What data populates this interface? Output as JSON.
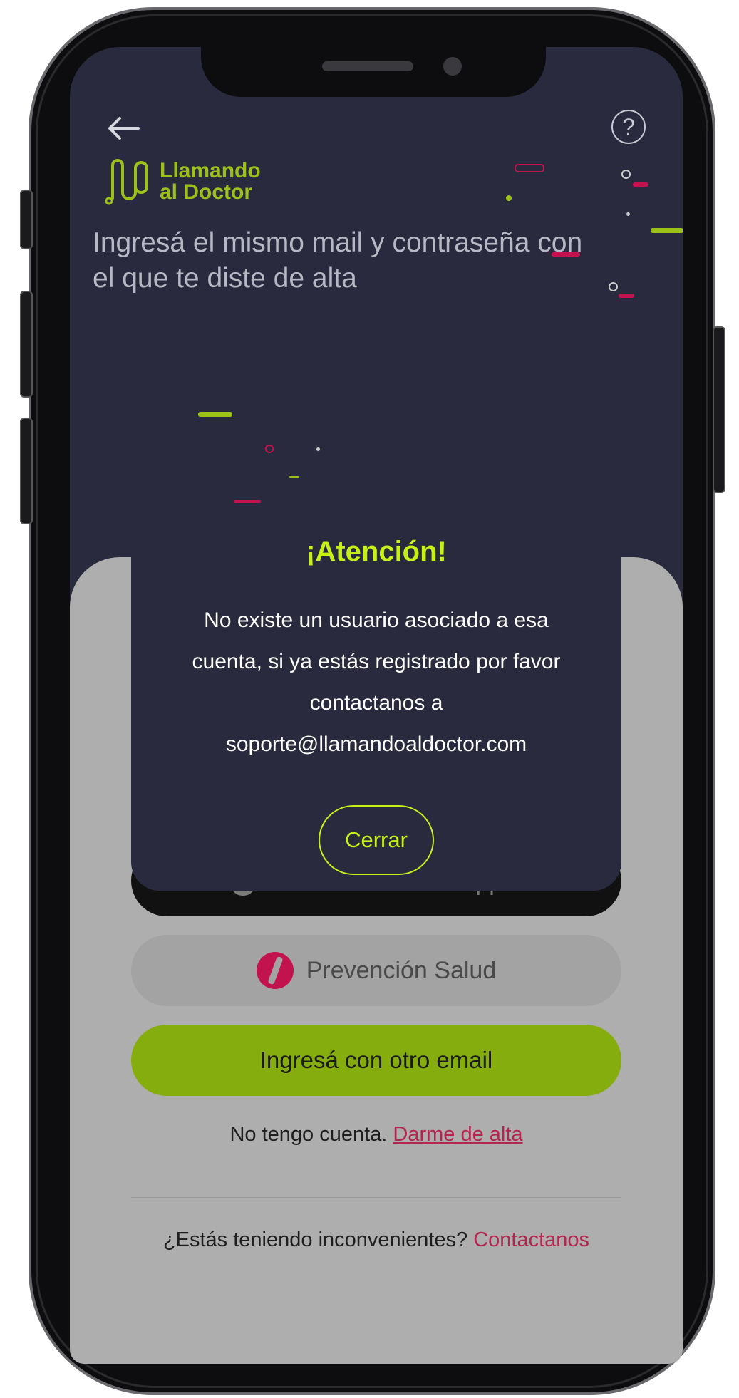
{
  "header": {
    "logo_line1": "Llamando",
    "logo_line2": "al Doctor",
    "subtitle": "Ingresá el mismo mail y contraseña con el que te diste de alta",
    "help_symbol": "?"
  },
  "login_options": {
    "apple_label": "Iniciar sesión con Apple",
    "prevencion_label": "Prevención Salud",
    "other_email_label": "Ingresá con otro email"
  },
  "footer": {
    "no_account_text": "No tengo cuenta. ",
    "signup_link": "Darme de alta",
    "trouble_text": "¿Estás teniendo inconvenientes? ",
    "contact_link": "Contactanos"
  },
  "modal": {
    "title": "¡Atención!",
    "message": "No existe un usuario asociado a esa cuenta, si ya estás registrado por favor contactanos a soporte@llamandoaldoctor.com",
    "close_label": "Cerrar"
  },
  "colors": {
    "brand_green": "#9cc21a",
    "accent_lime": "#c6f016",
    "accent_pink": "#c2134e",
    "screen_bg": "#2a2a3e"
  },
  "icons": {
    "back": "arrow-left-icon",
    "help": "help-circle-icon",
    "apple": "apple-icon",
    "prevencion": "prevencion-salud-logo"
  }
}
